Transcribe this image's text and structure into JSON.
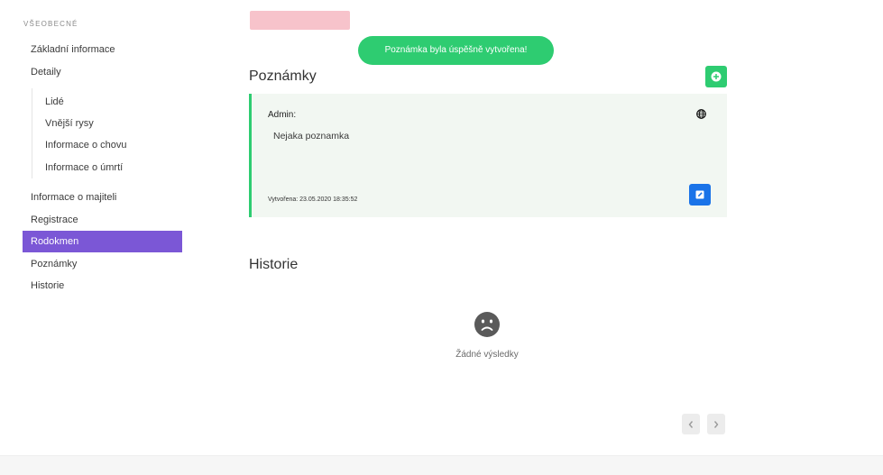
{
  "sidebar": {
    "section_title": "VŠEOBECNÉ",
    "items": [
      {
        "label": "Základní informace"
      },
      {
        "label": "Detaily"
      },
      {
        "label": "Informace o majiteli"
      },
      {
        "label": "Registrace"
      },
      {
        "label": "Rodokmen",
        "active": true
      },
      {
        "label": "Poznámky"
      },
      {
        "label": "Historie"
      }
    ],
    "sub_items": [
      {
        "label": "Lidé"
      },
      {
        "label": "Vnější rysy"
      },
      {
        "label": "Informace o chovu"
      },
      {
        "label": "Informace o úmrtí"
      }
    ]
  },
  "toast": {
    "text": "Poznámka byla úspěšně vytvořena!"
  },
  "notes": {
    "heading": "Poznámky",
    "add_icon": "plus-circle-icon",
    "card": {
      "author": "Admin:",
      "text": "Nejaka poznamka",
      "created": "Vytvořena: 23.05.2020 18:35:52",
      "visibility_icon": "globe-icon",
      "edit_icon": "edit-icon"
    }
  },
  "history": {
    "heading": "Historie",
    "empty_icon": "sad-face-icon",
    "empty_text": "Žádné výsledky",
    "pager": {
      "prev_icon": "chevron-left-icon",
      "next_icon": "chevron-right-icon"
    }
  },
  "colors": {
    "accent": "#7b57d6",
    "success": "#2ecc71",
    "primary": "#1a73e8",
    "pink": "#f7c3cb",
    "note_bg": "#f2f7f2"
  }
}
